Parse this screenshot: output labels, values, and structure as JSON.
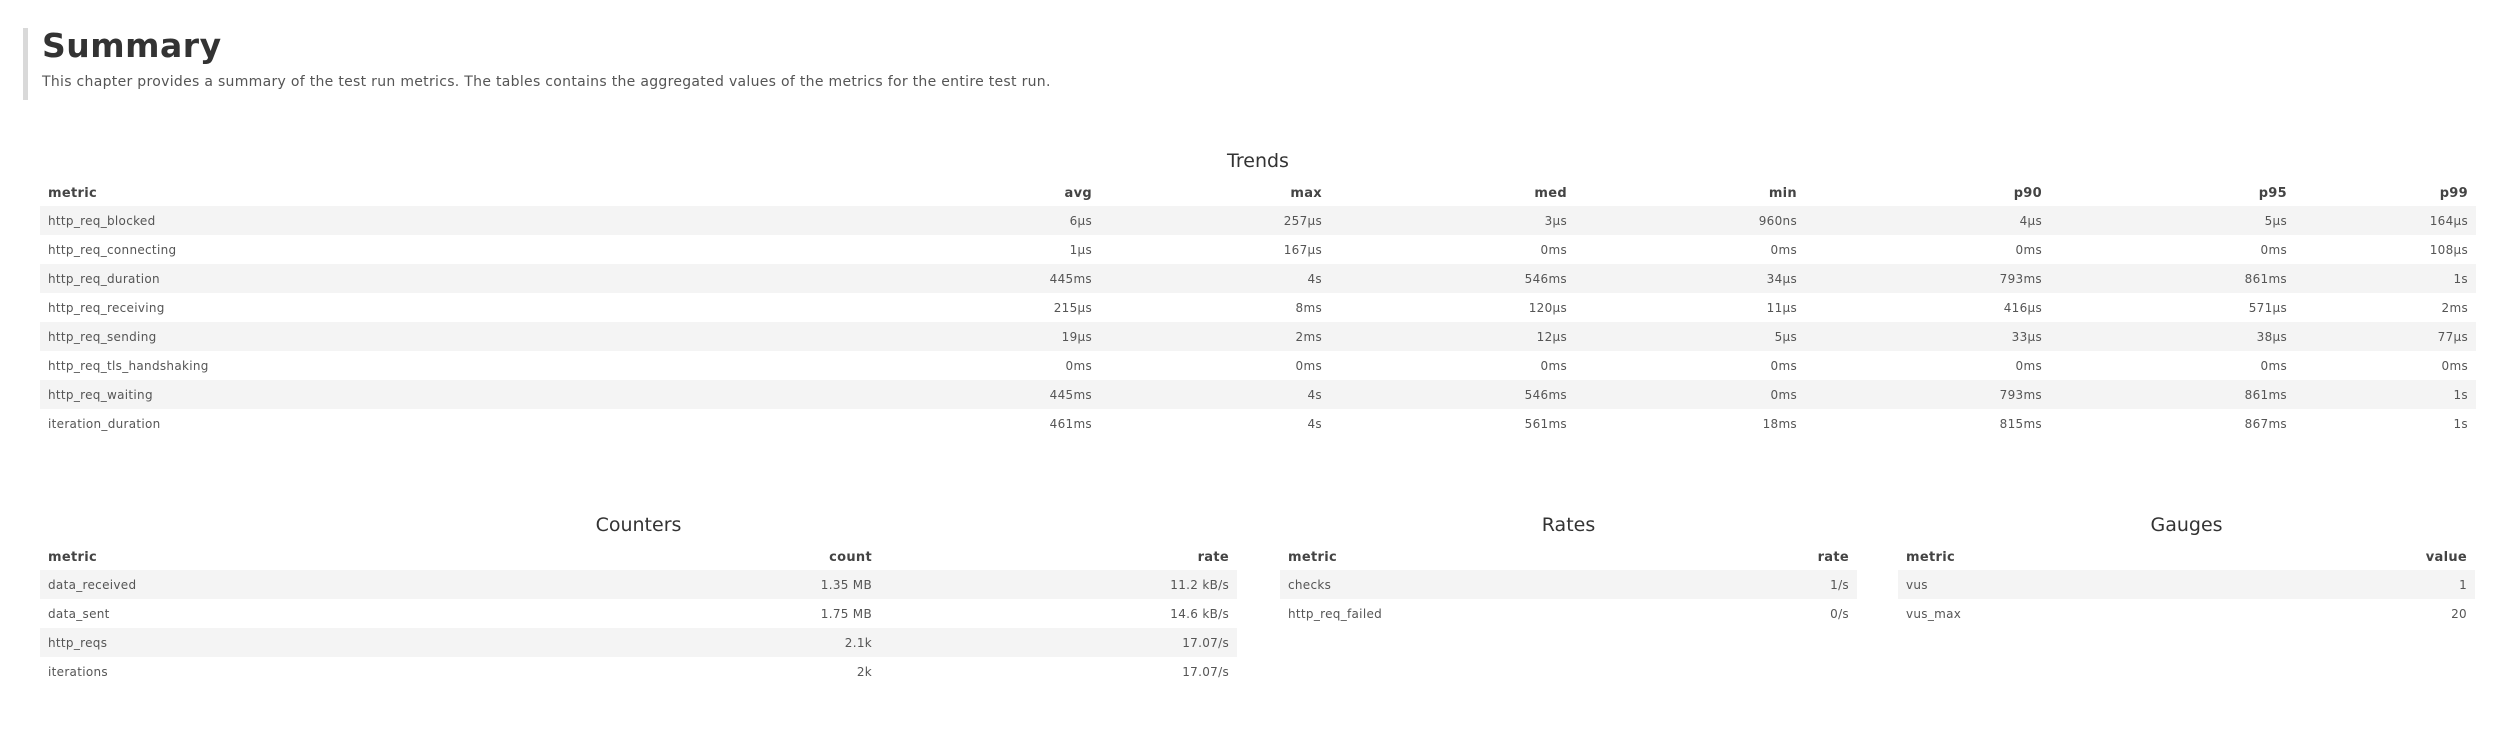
{
  "summary": {
    "title": "Summary",
    "description": "This chapter provides a summary of the test run metrics. The tables contains the aggregated values of the metrics for the entire test run."
  },
  "trends": {
    "title": "Trends",
    "columns": [
      "metric",
      "avg",
      "max",
      "med",
      "min",
      "p90",
      "p95",
      "p99"
    ],
    "rows": [
      [
        "http_req_blocked",
        "6µs",
        "257µs",
        "3µs",
        "960ns",
        "4µs",
        "5µs",
        "164µs"
      ],
      [
        "http_req_connecting",
        "1µs",
        "167µs",
        "0ms",
        "0ms",
        "0ms",
        "0ms",
        "108µs"
      ],
      [
        "http_req_duration",
        "445ms",
        "4s",
        "546ms",
        "34µs",
        "793ms",
        "861ms",
        "1s"
      ],
      [
        "http_req_receiving",
        "215µs",
        "8ms",
        "120µs",
        "11µs",
        "416µs",
        "571µs",
        "2ms"
      ],
      [
        "http_req_sending",
        "19µs",
        "2ms",
        "12µs",
        "5µs",
        "33µs",
        "38µs",
        "77µs"
      ],
      [
        "http_req_tls_handshaking",
        "0ms",
        "0ms",
        "0ms",
        "0ms",
        "0ms",
        "0ms",
        "0ms"
      ],
      [
        "http_req_waiting",
        "445ms",
        "4s",
        "546ms",
        "0ms",
        "793ms",
        "861ms",
        "1s"
      ],
      [
        "iteration_duration",
        "461ms",
        "4s",
        "561ms",
        "18ms",
        "815ms",
        "867ms",
        "1s"
      ]
    ]
  },
  "counters": {
    "title": "Counters",
    "columns": [
      "metric",
      "count",
      "rate"
    ],
    "rows": [
      [
        "data_received",
        "1.35 MB",
        "11.2 kB/s"
      ],
      [
        "data_sent",
        "1.75 MB",
        "14.6 kB/s"
      ],
      [
        "http_reqs",
        "2.1k",
        "17.07/s"
      ],
      [
        "iterations",
        "2k",
        "17.07/s"
      ]
    ]
  },
  "rates": {
    "title": "Rates",
    "columns": [
      "metric",
      "rate"
    ],
    "rows": [
      [
        "checks",
        "1/s"
      ],
      [
        "http_req_failed",
        "0/s"
      ]
    ]
  },
  "gauges": {
    "title": "Gauges",
    "columns": [
      "metric",
      "value"
    ],
    "rows": [
      [
        "vus",
        "1"
      ],
      [
        "vus_max",
        "20"
      ]
    ]
  }
}
